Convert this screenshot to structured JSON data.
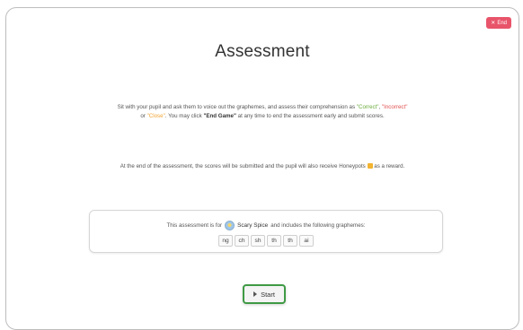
{
  "header": {
    "end_label": "End",
    "end_icon": "close-icon"
  },
  "title": "Assessment",
  "instructions": {
    "part1": "Sit with your pupil and ask them to voice out the graphemes, and assess their comprehension as ",
    "correct": "\"Correct\"",
    "comma1": ", ",
    "incorrect": "\"Incorrect\"",
    "part2": " or ",
    "close": "\"Close\"",
    "part3": ". You may click ",
    "end_game": "\"End Game\"",
    "part4": " at any time to end the assessment early and submit scores."
  },
  "reward": {
    "text1": "At the end of the assessment, the scores will be submitted and the pupil will also receive Honeypots",
    "icon": "honeypot-icon",
    "text2": "as a reward."
  },
  "info": {
    "prefix": "This assessment is for",
    "pupil_name": "Scary Spice",
    "suffix": "and includes the following graphemes:",
    "graphemes": [
      "ng",
      "ch",
      "sh",
      "th",
      "th",
      "ai"
    ]
  },
  "start_label": "Start",
  "colors": {
    "end_button": "#e8546a",
    "correct": "#6aab3a",
    "incorrect": "#e24f4f",
    "close": "#f0a330",
    "start_border": "#3f9a45"
  }
}
